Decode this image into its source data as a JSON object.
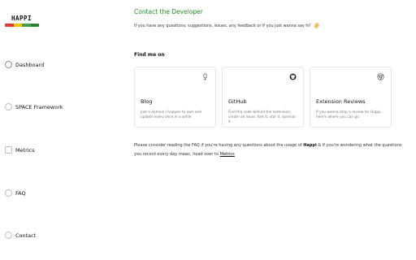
{
  "app": {
    "logo_text": "HAPPI",
    "logo_colors": [
      "#e53935",
      "#f2c200",
      "#43a047",
      "#2e7d32"
    ]
  },
  "sidebar": {
    "items": [
      {
        "label": "Dashboard",
        "icon": "dashboard-icon"
      },
      {
        "label": "SPACE Framework",
        "icon": "framework-icon"
      },
      {
        "label": "Metrics",
        "icon": "metrics-icon"
      },
      {
        "label": "FAQ",
        "icon": "faq-icon"
      },
      {
        "label": "Contact",
        "icon": "contact-icon"
      }
    ]
  },
  "main": {
    "title": "Contact the Developer",
    "intro": "If you have any questions, suggestions, issues, any feedback or if you just wanna say hi!",
    "intro_emoji": "waving-hand-icon",
    "section_heading": "Find me on",
    "cards": [
      {
        "title": "Blog",
        "description": "Just a domain I happen to own and update every once in a while",
        "icon": "microphone-icon"
      },
      {
        "title": "GitHub",
        "description": "Find the code behind the extension, create an issue, fork it, star it, sponsor it",
        "icon": "github-icon"
      },
      {
        "title": "Extension Reviews",
        "description": "If you wanna drop a review for Happi, here's where you can go",
        "icon": "chrome-icon"
      }
    ],
    "footer": {
      "part1": "Please consider reading the FAQ if you're having any questions about the usage of",
      "brand": "Happi",
      "part2": "& if you're wondering what the questions you record every day mean, head over to",
      "link": "Metrics"
    }
  },
  "colors": {
    "accent_green": "#2a8a2a"
  }
}
